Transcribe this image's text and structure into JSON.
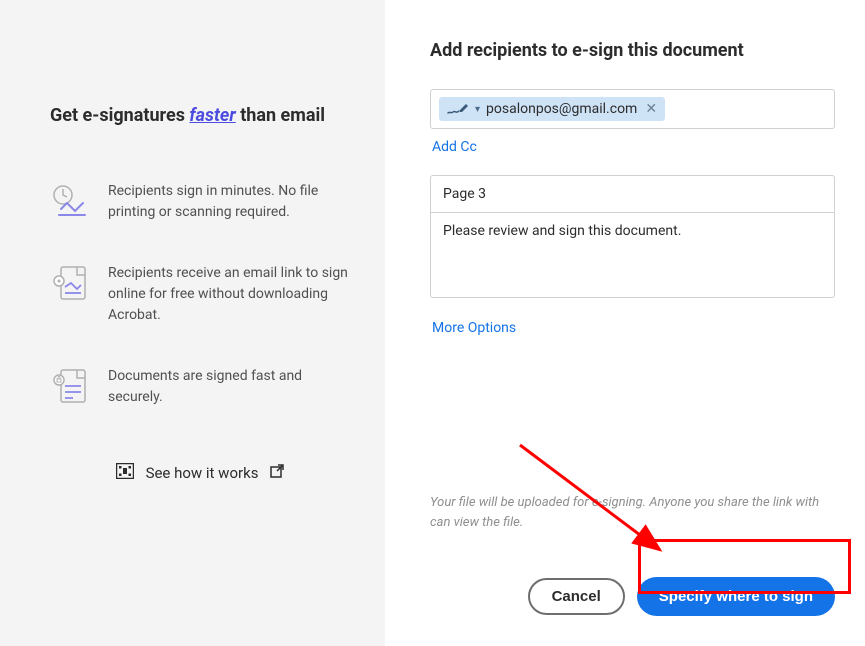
{
  "left": {
    "title_pre": "Get e-signatures ",
    "title_em": "faster",
    "title_post": " than email",
    "benefits": [
      "Recipients sign in minutes. No file printing or scanning required.",
      "Recipients receive an email link to sign online for free without downloading Acrobat.",
      "Documents are signed fast and securely."
    ],
    "how_it_works": "See how it works"
  },
  "right": {
    "title": "Add recipients to e-sign this document",
    "recipient_email": "posalonpos@gmail.com",
    "add_cc": "Add Cc",
    "subject": "Page 3",
    "message": "Please review and sign this document.",
    "more_options": "More Options",
    "disclaimer": "Your file will be uploaded for e-signing. Anyone you share the link with can view the file.",
    "cancel": "Cancel",
    "primary": "Specify where to sign"
  }
}
